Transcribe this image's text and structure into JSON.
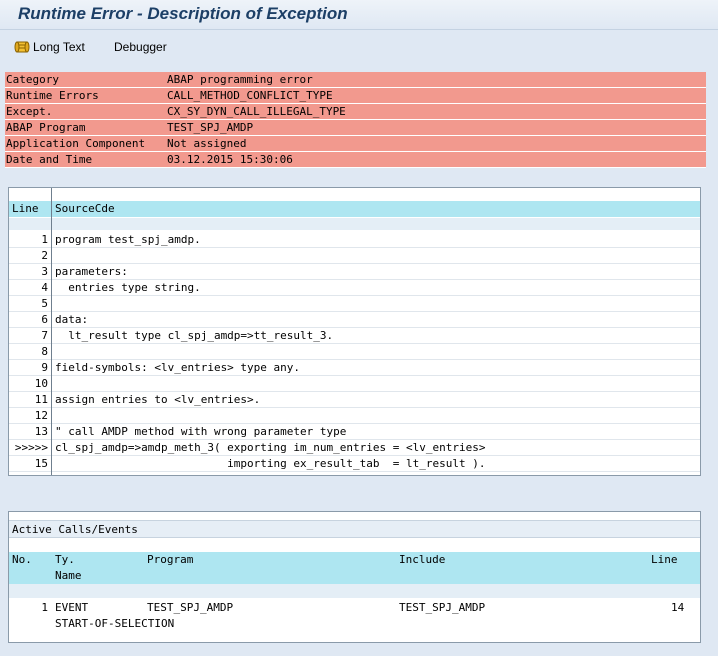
{
  "window": {
    "title": "Runtime Error - Description of Exception"
  },
  "toolbar": {
    "long_text_label": "Long Text",
    "debugger_label": "Debugger"
  },
  "error_header": {
    "rows": [
      {
        "label": "Category",
        "value": "ABAP programming error"
      },
      {
        "label": "Runtime Errors",
        "value": "CALL_METHOD_CONFLICT_TYPE"
      },
      {
        "label": "Except.",
        "value": "CX_SY_DYN_CALL_ILLEGAL_TYPE"
      },
      {
        "label": "ABAP Program",
        "value": "TEST_SPJ_AMDP"
      },
      {
        "label": "Application Component",
        "value": "Not assigned"
      },
      {
        "label": "Date and Time",
        "value": "03.12.2015 15:30:06"
      }
    ]
  },
  "source": {
    "col_line": "Line",
    "col_source": "SourceCde",
    "lines": [
      {
        "no": "1",
        "text": "program test_spj_amdp."
      },
      {
        "no": "2",
        "text": ""
      },
      {
        "no": "3",
        "text": "parameters:"
      },
      {
        "no": "4",
        "text": "  entries type string."
      },
      {
        "no": "5",
        "text": ""
      },
      {
        "no": "6",
        "text": "data:"
      },
      {
        "no": "7",
        "text": "  lt_result type cl_spj_amdp=>tt_result_3."
      },
      {
        "no": "8",
        "text": ""
      },
      {
        "no": "9",
        "text": "field-symbols: <lv_entries> type any."
      },
      {
        "no": "10",
        "text": ""
      },
      {
        "no": "11",
        "text": "assign entries to <lv_entries>."
      },
      {
        "no": "12",
        "text": ""
      },
      {
        "no": "13",
        "text": "\" call AMDP method with wrong parameter type"
      },
      {
        "no": ">>>>>",
        "text": "cl_spj_amdp=>amdp_meth_3( exporting im_num_entries = <lv_entries>"
      },
      {
        "no": "15",
        "text": "                          importing ex_result_tab  = lt_result )."
      }
    ]
  },
  "calls": {
    "title": "Active Calls/Events",
    "headers": {
      "no": "No.",
      "ty": "Ty.",
      "name": "Name",
      "program": "Program",
      "include": "Include",
      "line": "Line"
    },
    "rows": [
      {
        "no": "1",
        "ty": "EVENT",
        "name": "START-OF-SELECTION",
        "program": "TEST_SPJ_AMDP",
        "include": "TEST_SPJ_AMDP",
        "line": "14"
      }
    ]
  },
  "colors": {
    "error_bg": "#f2998e",
    "header_bg": "#aee6f1",
    "window_bg": "#dfe8f3",
    "title_color": "#1c3f66"
  }
}
